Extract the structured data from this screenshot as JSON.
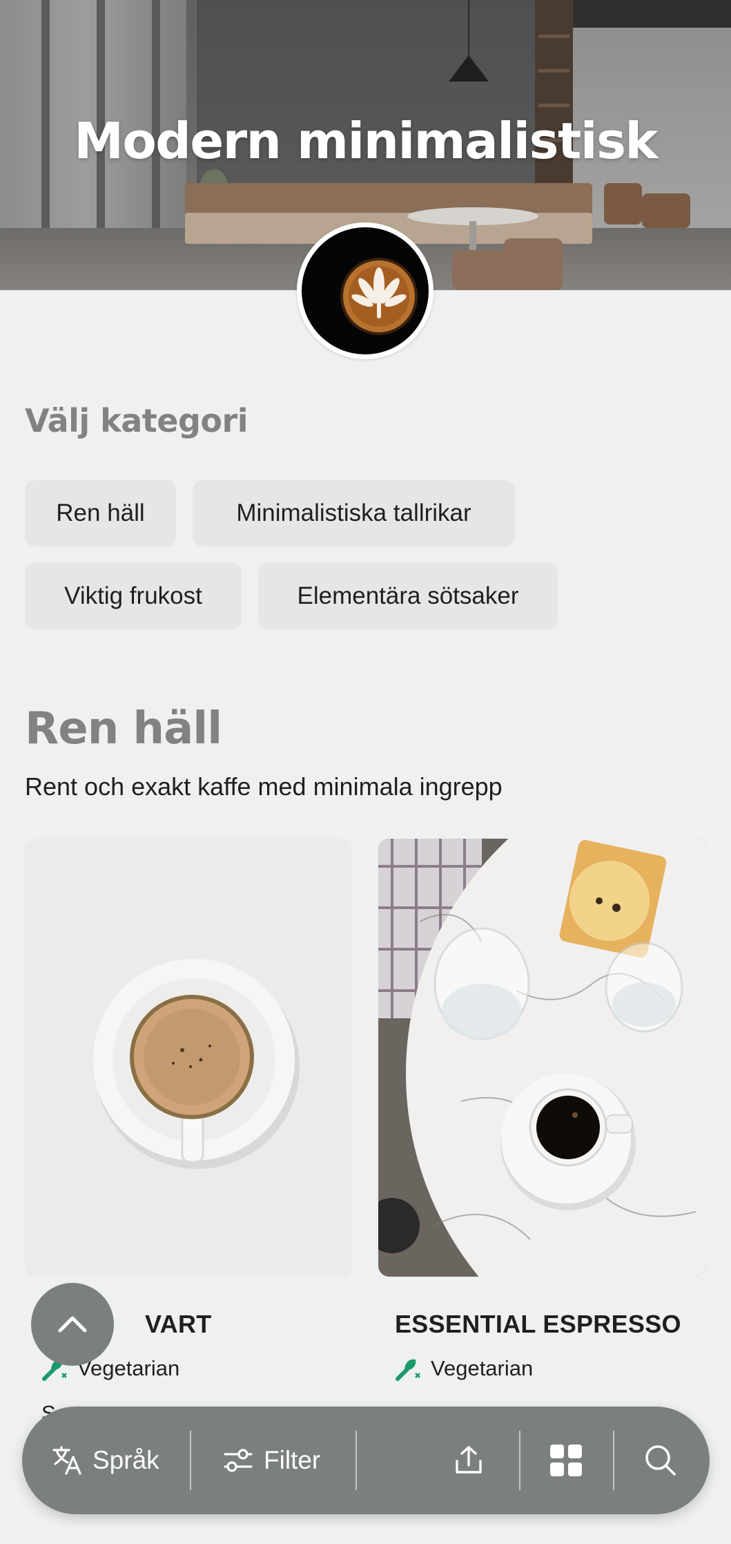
{
  "hero": {
    "title": "Modern minimalistisk"
  },
  "logo": {
    "icon": "latte-art-logo"
  },
  "categories": {
    "heading": "Välj kategori",
    "items": [
      {
        "label": "Ren häll"
      },
      {
        "label": "Minimalistiska tallrikar"
      },
      {
        "label": "Viktig frukost"
      },
      {
        "label": "Elementära sötsaker"
      }
    ]
  },
  "section": {
    "title": "Ren häll",
    "description": "Rent och exakt kaffe med minimala ingrepp"
  },
  "products": [
    {
      "name": "VART",
      "diet": "Vegetarian",
      "peek": "S"
    },
    {
      "name": "ESSENTIAL ESPRESSO",
      "diet": "Vegetarian",
      "peek": ""
    }
  ],
  "bottom_bar": {
    "language_label": "Språk",
    "filter_label": "Filter",
    "share_icon": "share-icon",
    "grid_icon": "grid-icon",
    "search_icon": "search-icon"
  },
  "colors": {
    "background": "#eff0f2",
    "chip": "#e5e6e8",
    "heading_grey": "#808283",
    "bar": "#7b7f80",
    "vegetarian_green": "#1a9a6a"
  }
}
